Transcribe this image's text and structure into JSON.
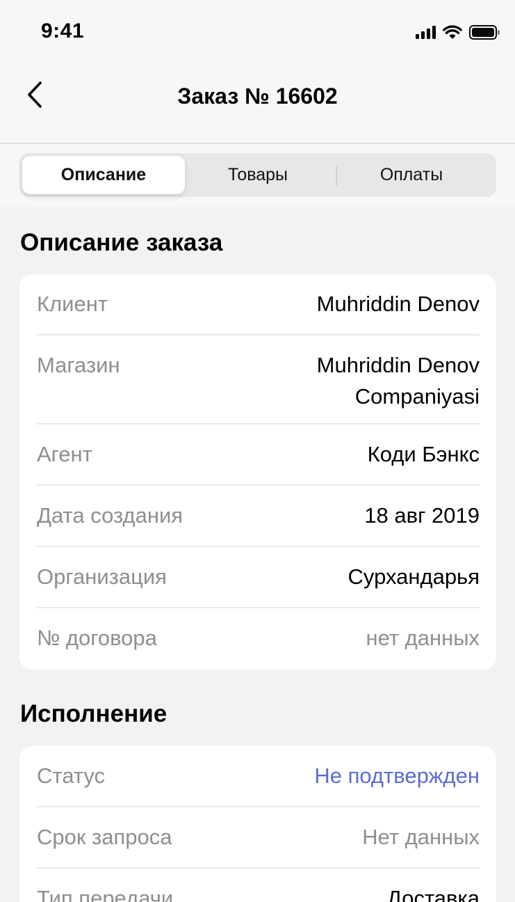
{
  "status_bar": {
    "time": "9:41"
  },
  "nav": {
    "title": "Заказ № 16602"
  },
  "tabs": [
    {
      "label": "Описание",
      "active": true
    },
    {
      "label": "Товары",
      "active": false
    },
    {
      "label": "Оплаты",
      "active": false
    }
  ],
  "order_description": {
    "title": "Описание заказа",
    "rows": [
      {
        "label": "Клиент",
        "value": "Muhriddin Denov"
      },
      {
        "label": "Магазин",
        "value": "Muhriddin Denov Companiyasi"
      },
      {
        "label": "Агент",
        "value": "Коди Бэнкс"
      },
      {
        "label": "Дата создания",
        "value": "18 авг 2019"
      },
      {
        "label": "Организация",
        "value": "Сурхандарья"
      },
      {
        "label": "№ договора",
        "value": "нет данных"
      }
    ]
  },
  "execution": {
    "title": "Исполнение",
    "rows": [
      {
        "label": "Статус",
        "value": "Не подтвержден"
      },
      {
        "label": "Срок запроса",
        "value": "Нет данных"
      },
      {
        "label": "Тип передачи",
        "value": "Доставка"
      }
    ]
  },
  "colors": {
    "accent": "#5c6bd3",
    "muted": "#8e8e93",
    "background": "#f2f2f2"
  }
}
